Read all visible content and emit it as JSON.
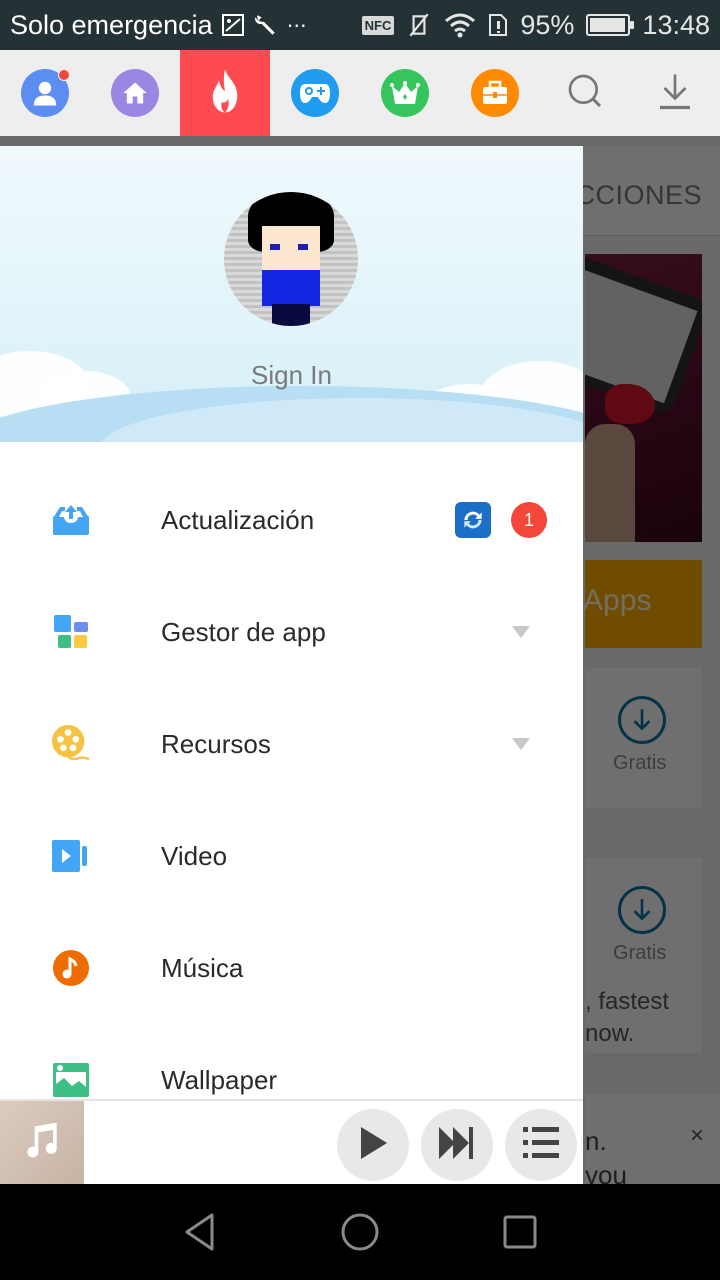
{
  "status_bar": {
    "carrier_text": "Solo emergencia",
    "left_icons": [
      "image-icon",
      "wrench-icon",
      "more-dots-icon"
    ],
    "right_icons": [
      "nfc-icon",
      "vibrate-off-icon",
      "wifi-icon",
      "sim-alert-icon"
    ],
    "nfc_label": "NFC",
    "battery_percent_text": "95%",
    "battery_level": 0.95,
    "time": "13:48"
  },
  "top_nav": {
    "items": [
      {
        "name": "profile",
        "icon": "user-icon",
        "color": "#5b8ef0",
        "has_notification": true
      },
      {
        "name": "home",
        "icon": "home-icon",
        "color": "#9b86e3"
      },
      {
        "name": "hot",
        "icon": "flame-icon",
        "color": "#ff4a51",
        "active": true
      },
      {
        "name": "games",
        "icon": "gamepad-icon",
        "color": "#1f9cf0"
      },
      {
        "name": "top",
        "icon": "crown-icon",
        "color": "#36c45c"
      },
      {
        "name": "tools",
        "icon": "toolbox-icon",
        "color": "#ff8a00"
      },
      {
        "name": "search",
        "icon": "search-icon"
      },
      {
        "name": "downloads",
        "icon": "download-icon"
      }
    ]
  },
  "background": {
    "tab_label": "ECCIONES",
    "apps_banner_text": "Apps",
    "cards": [
      {
        "price_label": "Gratis"
      },
      {
        "price_label": "Gratis",
        "description_lines": [
          ", fastest",
          "now."
        ]
      }
    ],
    "snackbar": {
      "lines": [
        "n.",
        "you"
      ],
      "close_label": "×"
    }
  },
  "drawer": {
    "header": {
      "sign_in_label": "Sign In"
    },
    "menu": [
      {
        "label": "Actualización",
        "icon": "upload-tray-icon",
        "icon_color": "#42a5f5",
        "count": "1",
        "has_update_icon": true
      },
      {
        "label": "Gestor de app",
        "icon": "app-manager-icon",
        "expandable": true
      },
      {
        "label": "Recursos",
        "icon": "film-reel-icon",
        "icon_color": "#f5c242",
        "expandable": true
      },
      {
        "label": "Video",
        "icon": "video-camera-icon",
        "icon_color": "#42a5f5"
      },
      {
        "label": "Música",
        "icon": "music-note-icon",
        "icon_color": "#ef6c00"
      },
      {
        "label": "Wallpaper",
        "icon": "image-icon",
        "icon_color": "#3dbf86"
      }
    ]
  },
  "player": {
    "controls": [
      "play",
      "skip-next",
      "playlist"
    ]
  },
  "nav_bar": {
    "buttons": [
      "back",
      "home",
      "recents"
    ]
  }
}
